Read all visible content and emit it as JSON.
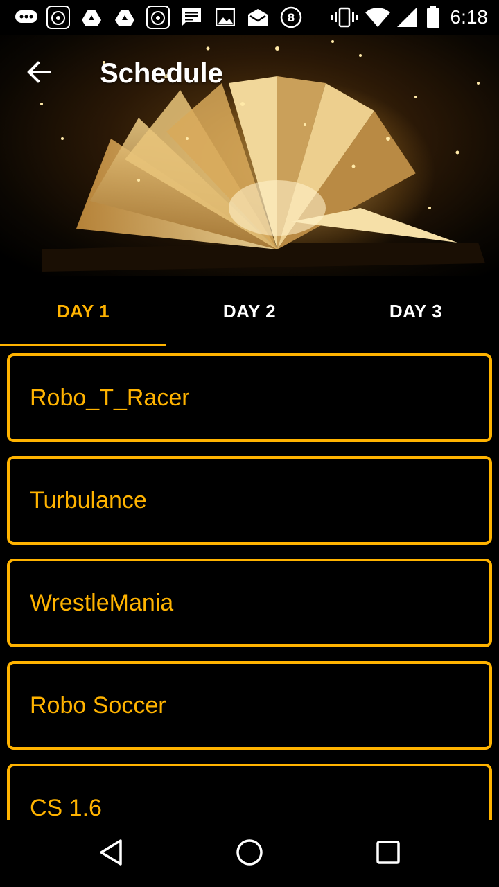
{
  "status_bar": {
    "time": "6:18",
    "icons": [
      "chat-bubble-icon",
      "app-logo-icon",
      "drive-icon",
      "drive-icon",
      "app-logo-icon",
      "message-icon",
      "gallery-icon",
      "email-icon",
      "eight-ball-icon",
      "vibrate-icon",
      "wifi-icon",
      "signal-icon",
      "battery-icon"
    ]
  },
  "toolbar": {
    "title": "Schedule",
    "back_icon": "arrow-left-icon"
  },
  "tabs": [
    {
      "label": "DAY 1",
      "active": true
    },
    {
      "label": "DAY 2",
      "active": false
    },
    {
      "label": "DAY 3",
      "active": false
    }
  ],
  "events": [
    {
      "name": "Robo_T_Racer"
    },
    {
      "name": "Turbulance"
    },
    {
      "name": "WrestleMania"
    },
    {
      "name": "Robo Soccer"
    },
    {
      "name": "CS 1.6"
    }
  ],
  "nav": {
    "back_icon": "triangle-back-icon",
    "home_icon": "circle-home-icon",
    "recents_icon": "square-recents-icon"
  },
  "colors": {
    "accent": "#FFB300",
    "background": "#000000",
    "text_primary": "#FFFFFF"
  }
}
